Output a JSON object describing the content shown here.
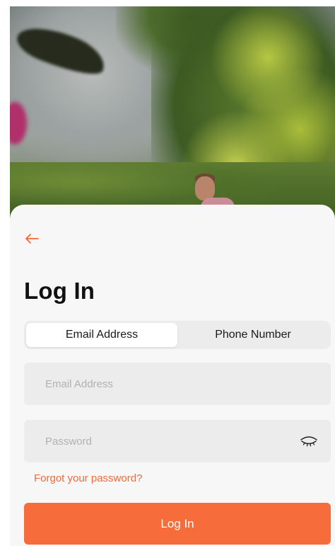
{
  "header": {
    "back_icon": "arrow-left-icon",
    "title": "Log In"
  },
  "tabs": [
    {
      "label": "Email Address",
      "selected": true
    },
    {
      "label": "Phone Number",
      "selected": false
    }
  ],
  "form": {
    "email_placeholder": "Email Address",
    "email_value": "",
    "password_placeholder": "Password",
    "password_value": "",
    "password_toggle_icon": "eye-closed-icon",
    "forgot_password": "Forgot your password?",
    "submit_label": "Log In"
  },
  "colors": {
    "accent": "#F26A3B",
    "button": "#F66D3B",
    "field_background": "#ECECEC",
    "sheet_background": "#F7F7F7"
  }
}
